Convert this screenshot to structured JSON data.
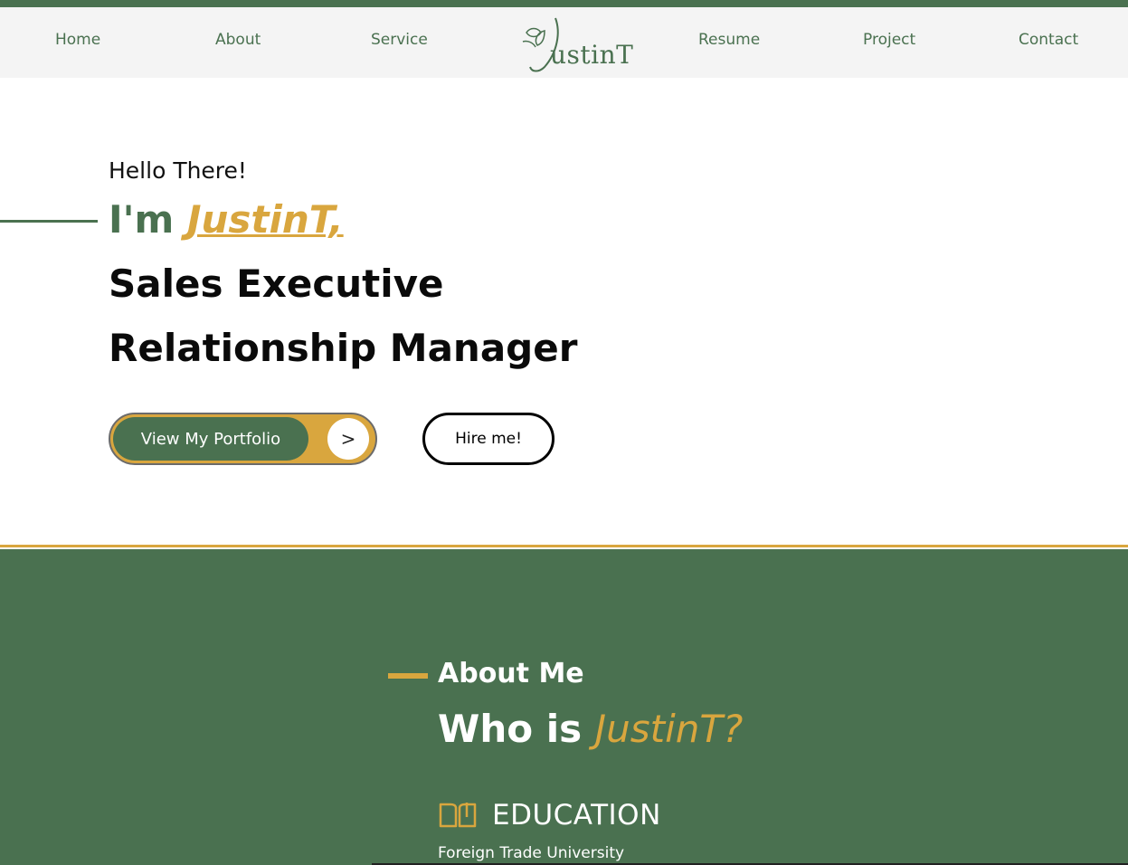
{
  "nav": {
    "items": [
      {
        "label": "Home"
      },
      {
        "label": "About"
      },
      {
        "label": "Service"
      },
      {
        "label": "Resume"
      },
      {
        "label": "Project"
      },
      {
        "label": "Contact"
      }
    ],
    "logo_text": "ustinT"
  },
  "hero": {
    "greeting": "Hello There!",
    "im_prefix": "I'm ",
    "name": "JustinT,",
    "role_1": "Sales Executive",
    "role_2": "Relationship Manager",
    "portfolio_button": "View My Portfolio",
    "portfolio_arrow": ">",
    "hire_button": "Hire me!"
  },
  "about": {
    "section_label": "About Me",
    "who_prefix": "Who is ",
    "who_name": "JustinT?",
    "education_title": "EDUCATION",
    "education_school": "Foreign Trade University"
  },
  "colors": {
    "brand_green": "#4a7150",
    "accent_gold": "#d9a63e",
    "nav_bg": "#f4f4f4"
  },
  "icons": {
    "logo": "leaf-j-logo-icon",
    "arrow": "chevron-right-icon",
    "education": "open-book-icon"
  }
}
